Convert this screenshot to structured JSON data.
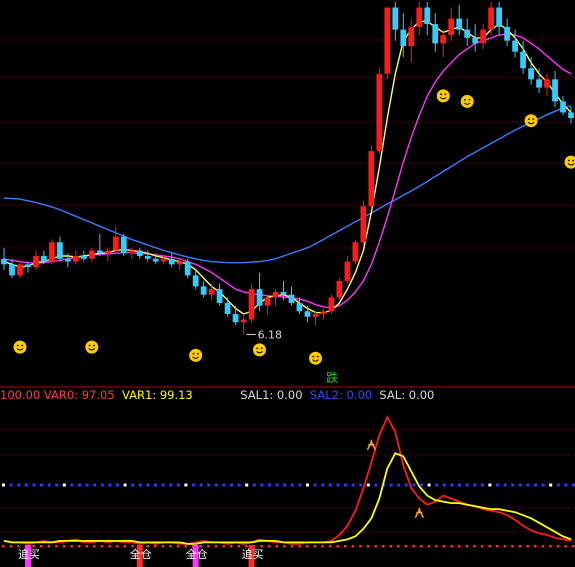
{
  "chart_data": [
    {
      "type": "candlestick",
      "panel": "main",
      "price_range": [
        5.5,
        12.2
      ],
      "low_annotation": "6.18",
      "colors": {
        "up": "#ff1a1a",
        "down": "#33ccff",
        "ma_short": "#ffff66",
        "ma_mid": "#ff33ff",
        "ma_long": "#3a7cff",
        "grid": "#7a0000"
      },
      "candles": [
        [
          7.55,
          7.75,
          7.35,
          7.45
        ],
        [
          7.45,
          7.55,
          7.2,
          7.25
        ],
        [
          7.25,
          7.5,
          7.2,
          7.45
        ],
        [
          7.45,
          7.5,
          7.3,
          7.4
        ],
        [
          7.4,
          7.7,
          7.35,
          7.6
        ],
        [
          7.6,
          7.7,
          7.45,
          7.5
        ],
        [
          7.5,
          7.9,
          7.45,
          7.85
        ],
        [
          7.85,
          7.95,
          7.5,
          7.55
        ],
        [
          7.55,
          7.65,
          7.4,
          7.5
        ],
        [
          7.5,
          7.7,
          7.45,
          7.6
        ],
        [
          7.6,
          7.7,
          7.5,
          7.55
        ],
        [
          7.55,
          7.75,
          7.5,
          7.7
        ],
        [
          7.7,
          8.0,
          7.6,
          7.65
        ],
        [
          7.65,
          7.75,
          7.5,
          7.7
        ],
        [
          7.7,
          8.15,
          7.65,
          7.95
        ],
        [
          7.95,
          8.0,
          7.6,
          7.65
        ],
        [
          7.65,
          7.75,
          7.55,
          7.7
        ],
        [
          7.7,
          7.75,
          7.55,
          7.6
        ],
        [
          7.6,
          7.7,
          7.5,
          7.55
        ],
        [
          7.55,
          7.65,
          7.45,
          7.5
        ],
        [
          7.5,
          7.6,
          7.45,
          7.55
        ],
        [
          7.55,
          7.65,
          7.4,
          7.45
        ],
        [
          7.45,
          7.55,
          7.35,
          7.5
        ],
        [
          7.5,
          7.55,
          7.2,
          7.25
        ],
        [
          7.25,
          7.35,
          7.0,
          7.05
        ],
        [
          7.05,
          7.15,
          6.85,
          6.9
        ],
        [
          6.9,
          7.1,
          6.8,
          7.0
        ],
        [
          7.0,
          7.1,
          6.7,
          6.75
        ],
        [
          6.75,
          6.85,
          6.5,
          6.55
        ],
        [
          6.55,
          6.7,
          6.35,
          6.4
        ],
        [
          6.4,
          6.55,
          6.18,
          6.45
        ],
        [
          6.45,
          7.1,
          6.4,
          7.0
        ],
        [
          7.0,
          7.3,
          6.6,
          6.7
        ],
        [
          6.7,
          6.9,
          6.55,
          6.85
        ],
        [
          6.85,
          7.0,
          6.7,
          6.95
        ],
        [
          6.95,
          7.15,
          6.8,
          6.9
        ],
        [
          6.9,
          7.05,
          6.7,
          6.75
        ],
        [
          6.75,
          6.85,
          6.55,
          6.6
        ],
        [
          6.6,
          6.7,
          6.4,
          6.5
        ],
        [
          6.5,
          6.6,
          6.35,
          6.55
        ],
        [
          6.55,
          6.65,
          6.45,
          6.6
        ],
        [
          6.6,
          6.9,
          6.55,
          6.85
        ],
        [
          6.85,
          7.2,
          6.8,
          7.15
        ],
        [
          7.15,
          7.6,
          7.1,
          7.5
        ],
        [
          7.5,
          7.9,
          7.45,
          7.85
        ],
        [
          7.85,
          8.6,
          7.8,
          8.5
        ],
        [
          8.5,
          9.6,
          8.45,
          9.5
        ],
        [
          9.5,
          11.0,
          9.45,
          10.9
        ],
        [
          10.9,
          12.1,
          10.8,
          12.1
        ],
        [
          12.1,
          12.2,
          11.5,
          11.7
        ],
        [
          11.7,
          12.0,
          11.2,
          11.4
        ],
        [
          11.4,
          11.9,
          11.1,
          11.75
        ],
        [
          11.75,
          12.2,
          11.6,
          12.1
        ],
        [
          12.1,
          12.2,
          11.6,
          11.8
        ],
        [
          11.8,
          12.0,
          11.3,
          11.45
        ],
        [
          11.45,
          11.7,
          11.2,
          11.6
        ],
        [
          11.6,
          12.1,
          11.5,
          11.9
        ],
        [
          11.9,
          12.15,
          11.6,
          11.7
        ],
        [
          11.7,
          11.9,
          11.4,
          11.55
        ],
        [
          11.55,
          11.8,
          11.3,
          11.45
        ],
        [
          11.45,
          11.8,
          11.35,
          11.7
        ],
        [
          11.7,
          12.2,
          11.6,
          12.1
        ],
        [
          12.1,
          12.2,
          11.6,
          11.75
        ],
        [
          11.75,
          11.9,
          11.4,
          11.5
        ],
        [
          11.5,
          11.7,
          11.2,
          11.3
        ],
        [
          11.3,
          11.5,
          10.9,
          11.0
        ],
        [
          11.0,
          11.2,
          10.7,
          10.8
        ],
        [
          10.8,
          11.0,
          10.55,
          10.65
        ],
        [
          10.65,
          10.9,
          10.5,
          10.8
        ],
        [
          10.8,
          10.95,
          10.3,
          10.4
        ],
        [
          10.4,
          10.5,
          10.15,
          10.2
        ],
        [
          10.2,
          10.3,
          10.0,
          10.1
        ]
      ],
      "ma_short": [
        7.5,
        7.45,
        7.4,
        7.42,
        7.48,
        7.5,
        7.55,
        7.6,
        7.6,
        7.58,
        7.6,
        7.62,
        7.65,
        7.66,
        7.7,
        7.72,
        7.7,
        7.68,
        7.65,
        7.6,
        7.57,
        7.53,
        7.5,
        7.45,
        7.35,
        7.2,
        7.05,
        6.95,
        6.8,
        6.65,
        6.55,
        6.6,
        6.75,
        6.85,
        6.88,
        6.9,
        6.85,
        6.75,
        6.65,
        6.58,
        6.57,
        6.62,
        6.75,
        7.0,
        7.3,
        7.7,
        8.4,
        9.2,
        10.1,
        10.9,
        11.5,
        11.7,
        11.85,
        11.85,
        11.75,
        11.65,
        11.7,
        11.75,
        11.65,
        11.55,
        11.55,
        11.7,
        11.8,
        11.7,
        11.55,
        11.35,
        11.1,
        10.9,
        10.75,
        10.55,
        10.35,
        10.2
      ],
      "ma_mid": [
        7.55,
        7.52,
        7.5,
        7.48,
        7.47,
        7.48,
        7.5,
        7.52,
        7.55,
        7.57,
        7.6,
        7.62,
        7.63,
        7.64,
        7.65,
        7.66,
        7.66,
        7.65,
        7.64,
        7.62,
        7.6,
        7.58,
        7.55,
        7.5,
        7.45,
        7.38,
        7.3,
        7.2,
        7.1,
        7.0,
        6.95,
        6.92,
        6.9,
        6.88,
        6.87,
        6.86,
        6.84,
        6.82,
        6.78,
        6.72,
        6.68,
        6.66,
        6.7,
        6.8,
        6.95,
        7.15,
        7.45,
        7.85,
        8.3,
        8.8,
        9.3,
        9.75,
        10.15,
        10.5,
        10.75,
        10.95,
        11.1,
        11.25,
        11.35,
        11.45,
        11.5,
        11.55,
        11.6,
        11.62,
        11.6,
        11.55,
        11.45,
        11.35,
        11.22,
        11.1,
        10.98,
        10.9
      ],
      "ma_long": [
        8.65,
        8.64,
        8.63,
        8.6,
        8.57,
        8.53,
        8.49,
        8.44,
        8.38,
        8.32,
        8.26,
        8.2,
        8.14,
        8.08,
        8.02,
        7.96,
        7.9,
        7.85,
        7.8,
        7.75,
        7.7,
        7.66,
        7.62,
        7.58,
        7.55,
        7.52,
        7.5,
        7.49,
        7.48,
        7.48,
        7.48,
        7.49,
        7.5,
        7.52,
        7.55,
        7.6,
        7.65,
        7.7,
        7.75,
        7.82,
        7.9,
        7.98,
        8.06,
        8.14,
        8.22,
        8.3,
        8.38,
        8.46,
        8.54,
        8.62,
        8.7,
        8.78,
        8.86,
        8.95,
        9.04,
        9.13,
        9.22,
        9.31,
        9.4,
        9.48,
        9.56,
        9.64,
        9.72,
        9.8,
        9.88,
        9.95,
        10.02,
        10.09,
        10.16,
        10.22,
        10.28,
        10.32
      ]
    },
    {
      "type": "line",
      "panel": "indicator",
      "ylim": [
        0,
        100
      ],
      "legend": [
        {
          "text": "100.00",
          "color": "#ff3b3b"
        },
        {
          "text": "VAR0: 97.05",
          "color": "#ff3b3b"
        },
        {
          "text": "VAR1: 99.13",
          "color": "#ffff00"
        },
        {
          "text": "SAL1: 0.00",
          "color": "#d9d9d9"
        },
        {
          "text": "SAL2: 0.00",
          "color": "#2e4cff"
        },
        {
          "text": "SAL: 0.00",
          "color": "#d9d9d9"
        }
      ],
      "series": [
        {
          "name": "VAR0",
          "color": "#ff1a1a",
          "values": [
            10,
            9,
            9,
            8,
            9,
            10,
            9,
            9,
            10,
            11,
            9,
            9,
            10,
            9,
            10,
            9,
            9,
            8,
            9,
            8,
            9,
            9,
            8,
            8,
            9,
            10,
            9,
            9,
            8,
            9,
            8,
            9,
            11,
            10,
            9,
            9,
            8,
            8,
            9,
            9,
            9,
            10,
            14,
            20,
            30,
            45,
            62,
            80,
            92,
            82,
            60,
            45,
            38,
            34,
            36,
            40,
            38,
            36,
            34,
            33,
            31,
            30,
            29,
            27,
            24,
            20,
            17,
            15,
            14,
            12,
            11,
            10
          ]
        },
        {
          "name": "VAR1",
          "color": "#ffff00",
          "values": [
            10,
            9,
            9,
            9,
            9,
            9,
            9,
            10,
            10,
            10,
            10,
            10,
            10,
            10,
            10,
            10,
            10,
            9,
            9,
            9,
            9,
            9,
            9,
            8,
            8,
            9,
            9,
            9,
            9,
            9,
            9,
            9,
            10,
            10,
            10,
            9,
            9,
            9,
            9,
            9,
            9,
            9,
            10,
            11,
            13,
            18,
            25,
            38,
            58,
            68,
            66,
            56,
            46,
            40,
            37,
            36,
            35,
            35,
            34,
            33,
            32,
            31,
            31,
            30,
            29,
            27,
            25,
            22,
            19,
            16,
            13,
            11
          ]
        }
      ],
      "markers": [
        {
          "text": "追买"
        },
        {
          "text": "全仓"
        },
        {
          "text": "全仓"
        },
        {
          "text": "追买"
        }
      ],
      "top_badge": "跌"
    }
  ]
}
